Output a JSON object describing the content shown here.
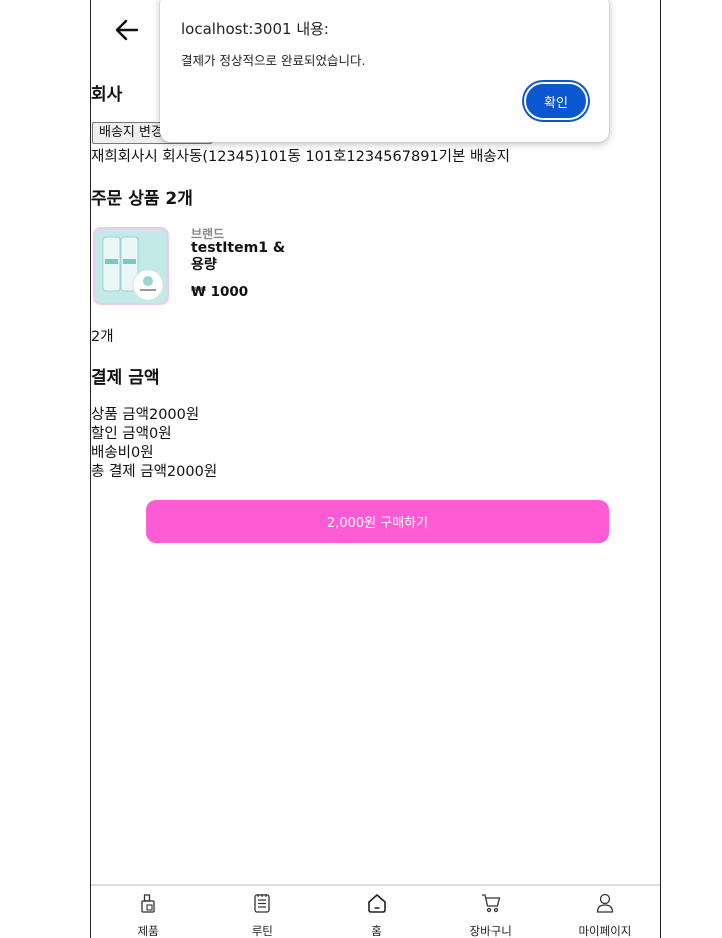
{
  "header": {
    "back_icon": "arrow-left-icon"
  },
  "company": {
    "title": "회사",
    "change_address_button": "배송지 변경",
    "address": "재희회사시 회사동(12345)101동 101호1234567891기본 배송지"
  },
  "order_items": {
    "title": "주문 상품 2개",
    "product": {
      "brand": "브랜드",
      "name": "testItem1 & 용량",
      "price": "₩ 1000"
    },
    "quantity": "2개"
  },
  "payment": {
    "title": "결제 금액",
    "lines": [
      "상품 금액2000원",
      "할인 금액0원",
      "배송비0원",
      "총 결제 금액2000원"
    ]
  },
  "buy_button": "2,000원 구매하기",
  "bottom_nav": [
    {
      "label": "제품",
      "icon": "product-icon"
    },
    {
      "label": "루틴",
      "icon": "routine-icon"
    },
    {
      "label": "홈",
      "icon": "home-icon"
    },
    {
      "label": "장바구니",
      "icon": "cart-icon"
    },
    {
      "label": "마이페이지",
      "icon": "user-icon"
    }
  ],
  "dialog": {
    "title": "localhost:3001 내용:",
    "message": "결제가 정상적으로 완료되었습니다.",
    "ok_button": "확인"
  },
  "colors": {
    "accent": "#ff5bd5",
    "dialog_button": "#0b57d0",
    "thumb_border": "#f6c6ec"
  }
}
